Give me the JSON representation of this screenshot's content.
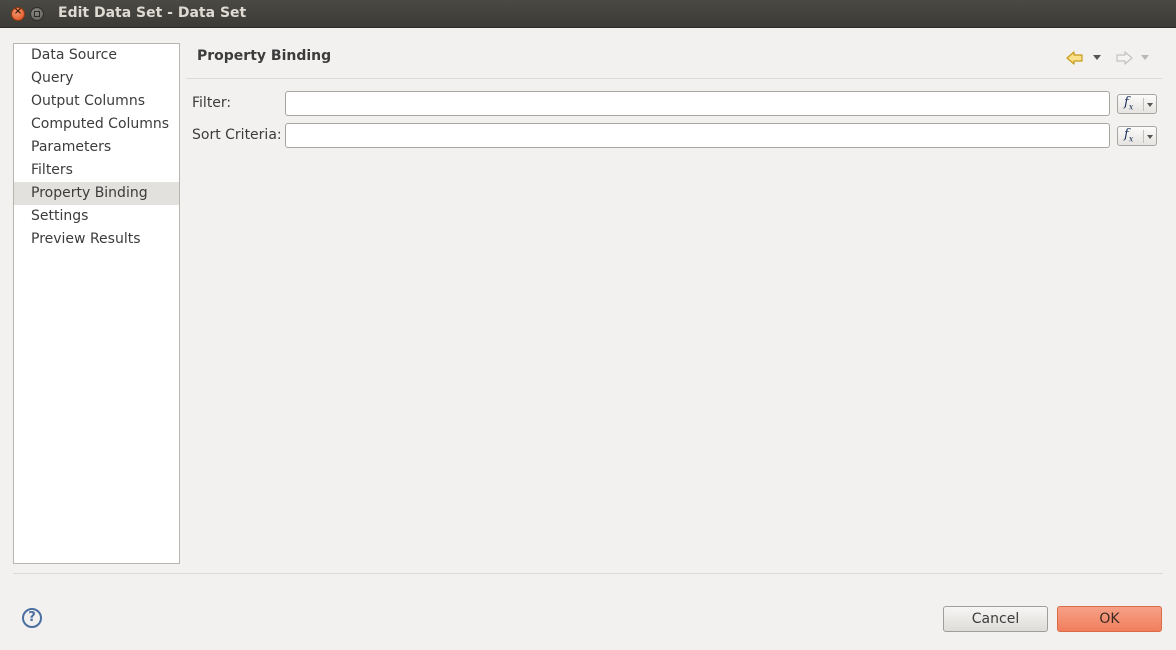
{
  "window": {
    "title": "Edit Data Set - Data Set"
  },
  "nav": {
    "items": [
      {
        "label": "Data Source"
      },
      {
        "label": "Query"
      },
      {
        "label": "Output Columns"
      },
      {
        "label": "Computed Columns"
      },
      {
        "label": "Parameters"
      },
      {
        "label": "Filters"
      },
      {
        "label": "Property Binding",
        "selected": true
      },
      {
        "label": "Settings"
      },
      {
        "label": "Preview Results"
      }
    ]
  },
  "page": {
    "title": "Property Binding",
    "back_icon": "back-arrow-icon",
    "forward_icon": "forward-arrow-icon"
  },
  "fields": {
    "filter": {
      "label": "Filter:",
      "value": ""
    },
    "sort": {
      "label": "Sort Criteria:",
      "value": ""
    }
  },
  "footer": {
    "cancel_label": "Cancel",
    "ok_label": "OK",
    "help_icon": "help-icon"
  },
  "colors": {
    "titlebar": "#3c3b37",
    "ok_button": "#f07f5c",
    "background": "#f2f1f0"
  }
}
